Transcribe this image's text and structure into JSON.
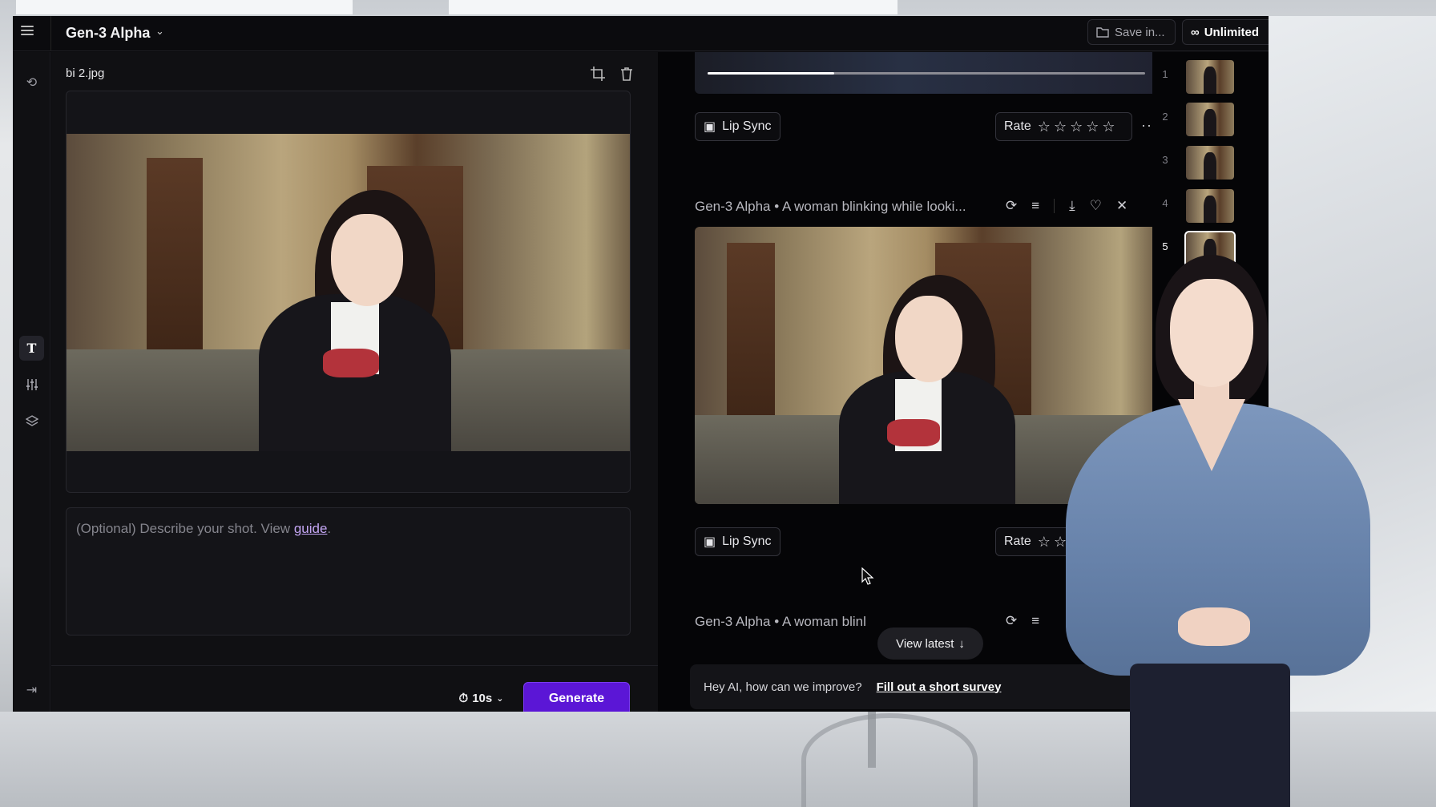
{
  "topbar": {
    "model_name": "Gen-3 Alpha",
    "save_label": "Save in...",
    "plan_label": "Unlimited"
  },
  "left_panel": {
    "file_name": "bi 2.jpg",
    "prompt_placeholder": "(Optional) Describe your shot. View ",
    "prompt_link": "guide",
    "prompt_suffix": ".",
    "duration": "10s",
    "generate_label": "Generate"
  },
  "feed": {
    "top_item": {
      "lip_sync_label": "Lip Sync",
      "rate_label": "Rate",
      "progress": 0.29
    },
    "item_2": {
      "title": "Gen-3 Alpha • A woman blinking while looki...",
      "lip_sync_label": "Lip Sync",
      "rate_label": "Rate"
    },
    "item_3": {
      "title": "Gen-3 Alpha • A woman blinl"
    },
    "view_latest_label": "View latest",
    "survey_question": "Hey AI, how can we improve?",
    "survey_link": "Fill out a short survey"
  },
  "thumbnails": [
    {
      "num": "1"
    },
    {
      "num": "2"
    },
    {
      "num": "3"
    },
    {
      "num": "4"
    },
    {
      "num": "5"
    }
  ],
  "colors": {
    "accent": "#5b16d6",
    "link": "#c4a6f4"
  }
}
